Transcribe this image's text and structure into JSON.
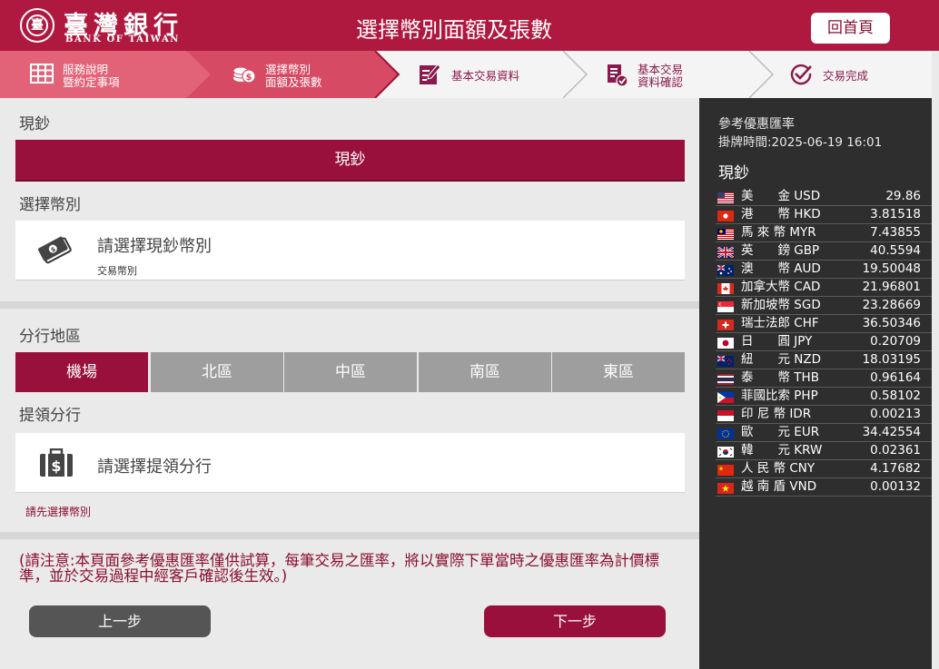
{
  "header": {
    "logo_zh": "臺灣銀行",
    "logo_en": "BANK OF TAIWAN",
    "title": "選擇幣別面額及張數",
    "home_label": "回首頁"
  },
  "steps": [
    {
      "line1": "服務說明",
      "line2": "暨約定事項",
      "icon": "grid-icon"
    },
    {
      "line1": "選擇幣別",
      "line2": "面額及張數",
      "icon": "coins-icon"
    },
    {
      "line1": "基本交易資料",
      "line2": "",
      "icon": "form-edit-icon"
    },
    {
      "line1": "基本交易",
      "line2": "資料確認",
      "icon": "document-check-icon"
    },
    {
      "line1": "交易完成",
      "line2": "",
      "icon": "check-circle-icon"
    }
  ],
  "main": {
    "cash_section_label": "現鈔",
    "cash_bar_label": "現鈔",
    "currency_section_label": "選擇幣別",
    "currency_placeholder": "請選擇現鈔幣別",
    "currency_sub": "交易幣別",
    "region_section_label": "分行地區",
    "regions": [
      "機場",
      "北區",
      "中區",
      "南區",
      "東區"
    ],
    "active_region": "機場",
    "branch_section_label": "提領分行",
    "branch_placeholder": "請選擇提領分行",
    "branch_note": "請先選擇幣別",
    "notice": "(請注意:本頁面參考優惠匯率僅供試算，每筆交易之匯率，將以實際下單當時之優惠匯率為計價標準，並於交易過程中經客戶確認後生效。)",
    "prev_label": "上一步",
    "next_label": "下一步"
  },
  "rates": {
    "title": "參考優惠匯率",
    "time": "掛牌時間:2025-06-19 16:01",
    "category": "現鈔",
    "rows": [
      {
        "flag": "us",
        "name": "美　　金 USD",
        "value": "29.86"
      },
      {
        "flag": "hk",
        "name": "港　　幣 HKD",
        "value": "3.81518"
      },
      {
        "flag": "my",
        "name": "馬 來 幣 MYR",
        "value": "7.43855"
      },
      {
        "flag": "gb",
        "name": "英　　鎊 GBP",
        "value": "40.5594"
      },
      {
        "flag": "au",
        "name": "澳　　幣 AUD",
        "value": "19.50048"
      },
      {
        "flag": "ca",
        "name": "加拿大幣 CAD",
        "value": "21.96801"
      },
      {
        "flag": "sg",
        "name": "新加坡幣 SGD",
        "value": "23.28669"
      },
      {
        "flag": "ch",
        "name": "瑞士法郎 CHF",
        "value": "36.50346"
      },
      {
        "flag": "jp",
        "name": "日　　圓 JPY",
        "value": "0.20709"
      },
      {
        "flag": "nz",
        "name": "紐　　元 NZD",
        "value": "18.03195"
      },
      {
        "flag": "th",
        "name": "泰　　幣 THB",
        "value": "0.96164"
      },
      {
        "flag": "ph",
        "name": "菲國比索 PHP",
        "value": "0.58102"
      },
      {
        "flag": "id",
        "name": "印 尼 幣 IDR",
        "value": "0.00213"
      },
      {
        "flag": "eu",
        "name": "歐　　元 EUR",
        "value": "34.42554"
      },
      {
        "flag": "kr",
        "name": "韓　　元 KRW",
        "value": "0.02361"
      },
      {
        "flag": "cn",
        "name": "人 民 幣 CNY",
        "value": "4.17682"
      },
      {
        "flag": "vn",
        "name": "越 南 盾 VND",
        "value": "0.00132"
      }
    ]
  },
  "colors": {
    "brand": "#b0193f",
    "accent": "#98103b",
    "panel": "#2e2e2e",
    "tab_inactive": "#9e9e9e"
  }
}
